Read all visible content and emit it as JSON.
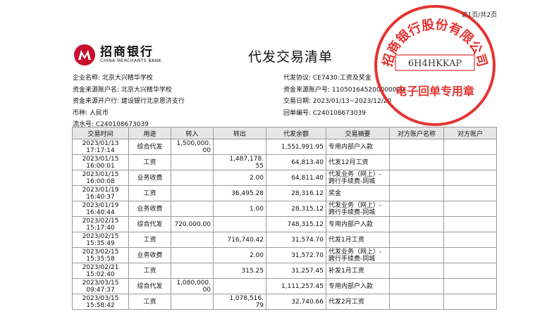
{
  "page_indicator": "第1页/共2页",
  "bank": {
    "name_cn": "招商银行",
    "name_en": "CHINA MERCHANTS BANK"
  },
  "title": "代发交易清单",
  "info_left": [
    "企业名称: 北京大兴精华学校",
    "资金来源账户名: 北京大兴精华学校",
    "资金来源开户行: 建设银行北京恩济支行",
    "币种: 人民币",
    "流水号: C240108673039"
  ],
  "info_right": [
    "代发协议: CE7430:工资及奖金",
    "资金来源账户号: 110501645200000000",
    "交易日期: 2023/01/13~2023/12/20",
    "回单编号: C240108673039"
  ],
  "table": {
    "headers": [
      "交易时间",
      "用途",
      "转入",
      "转出",
      "代发余额",
      "交易摘要",
      "对方账户名称",
      "对方账户"
    ],
    "rows": [
      {
        "time": [
          "2023/01/13",
          "17:17:14"
        ],
        "purpose": "综合代发",
        "in": [
          "1,500,000.",
          "00"
        ],
        "out": [
          ""
        ],
        "balance": "1,551,991.95",
        "summary": [
          "专用内部户入款"
        ],
        "party_name": "",
        "party_account": ""
      },
      {
        "time": [
          "2023/01/15",
          "16:00:01"
        ],
        "purpose": "工资",
        "in": [
          ""
        ],
        "out": [
          "1,487,178.",
          "55"
        ],
        "balance": "64,813.40",
        "summary": [
          "代发12月工资"
        ],
        "party_name": "",
        "party_account": ""
      },
      {
        "time": [
          "2023/01/15",
          "16:00:08"
        ],
        "purpose": "业务收费",
        "in": [
          ""
        ],
        "out": [
          "2.00"
        ],
        "balance": "64,811.40",
        "summary": [
          "代发业务（网上）-",
          "跨行手续费-同城"
        ],
        "party_name": "",
        "party_account": ""
      },
      {
        "time": [
          "2023/01/19",
          "16:40:37"
        ],
        "purpose": "工资",
        "in": [
          ""
        ],
        "out": [
          "36,495.28"
        ],
        "balance": "28,316.12",
        "summary": [
          "奖金"
        ],
        "party_name": "",
        "party_account": ""
      },
      {
        "time": [
          "2023/01/19",
          "16:40:44"
        ],
        "purpose": "业务收费",
        "in": [
          ""
        ],
        "out": [
          "1.00"
        ],
        "balance": "28,315.12",
        "summary": [
          "代发业务（网上）-",
          "跨行手续费-同城"
        ],
        "party_name": "",
        "party_account": ""
      },
      {
        "time": [
          "2023/02/15",
          "15:17:40"
        ],
        "purpose": "综合代发",
        "in": [
          "720,000.00"
        ],
        "out": [
          ""
        ],
        "balance": "748,315.12",
        "summary": [
          "专用内部户入款"
        ],
        "party_name": "",
        "party_account": ""
      },
      {
        "time": [
          "2023/02/15",
          "15:35:49"
        ],
        "purpose": "工资",
        "in": [
          ""
        ],
        "out": [
          "716,740.42"
        ],
        "balance": "31,574.70",
        "summary": [
          "代发1月工资"
        ],
        "party_name": "",
        "party_account": ""
      },
      {
        "time": [
          "2023/02/15",
          "15:35:58"
        ],
        "purpose": "业务收费",
        "in": [
          ""
        ],
        "out": [
          "2.00"
        ],
        "balance": "31,572.70",
        "summary": [
          "代发业务（网上）-",
          "跨行手续费-同城"
        ],
        "party_name": "",
        "party_account": ""
      },
      {
        "time": [
          "2023/02/21",
          "15:02:40"
        ],
        "purpose": "工资",
        "in": [
          ""
        ],
        "out": [
          "315.25"
        ],
        "balance": "31,257.45",
        "summary": [
          "补发1月工资"
        ],
        "party_name": "",
        "party_account": ""
      },
      {
        "time": [
          "2023/03/15",
          "09:47:37"
        ],
        "purpose": "综合代发",
        "in": [
          "1,080,000.",
          "00"
        ],
        "out": [
          ""
        ],
        "balance": "1,111,257.45",
        "summary": [
          "专用内部户入款"
        ],
        "party_name": "",
        "party_account": ""
      },
      {
        "time": [
          "2023/03/15",
          "15:58:42"
        ],
        "purpose": "工资",
        "in": [
          ""
        ],
        "out": [
          "1,078,516.",
          "79"
        ],
        "balance": "32,740.66",
        "summary": [
          "代发2月工资"
        ],
        "party_name": "",
        "party_account": ""
      }
    ]
  },
  "stamp": {
    "top_text": "招商银行股份有限公司",
    "code": "6H4HKKAP",
    "bottom_text": "电子回单专用章",
    "color": "#e0201c"
  },
  "colors": {
    "logo_red": "#c8102e",
    "header_bg": "#e6e6e6"
  }
}
